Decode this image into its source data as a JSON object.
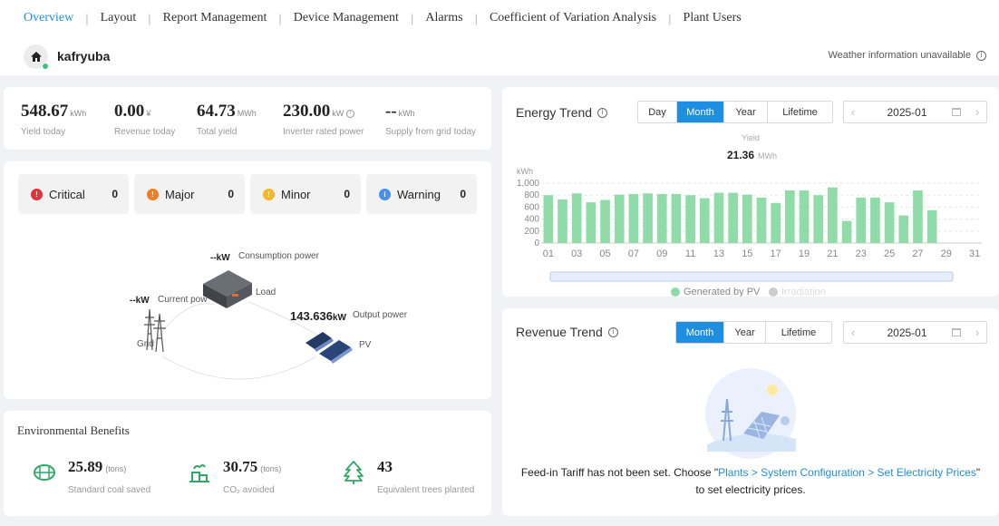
{
  "nav": {
    "items": [
      {
        "label": "Overview",
        "active": true
      },
      {
        "label": "Layout"
      },
      {
        "label": "Report Management"
      },
      {
        "label": "Device Management"
      },
      {
        "label": "Alarms"
      },
      {
        "label": "Coefficient of Variation Analysis"
      },
      {
        "label": "Plant Users"
      }
    ]
  },
  "plant": {
    "name": "kafryuba",
    "status_color": "#3cc27a",
    "weather": "Weather information unavailable"
  },
  "kpis": [
    {
      "value": "548.67",
      "unit": "kWh",
      "label": "Yield today"
    },
    {
      "value": "0.00",
      "unit": "¥",
      "label": "Revenue today"
    },
    {
      "value": "64.73",
      "unit": "MWh",
      "label": "Total yield"
    },
    {
      "value": "230.00",
      "unit": "kW",
      "label": "Inverter rated power"
    },
    {
      "value": "--",
      "unit": "kWh",
      "label": "Supply from grid today"
    }
  ],
  "alarms": [
    {
      "label": "Critical",
      "count": "0",
      "color": "#e0343a",
      "glyph": "!"
    },
    {
      "label": "Major",
      "count": "0",
      "color": "#f07c23",
      "glyph": "!"
    },
    {
      "label": "Minor",
      "count": "0",
      "color": "#f5b62a",
      "glyph": "!"
    },
    {
      "label": "Warning",
      "count": "0",
      "color": "#4a8ef0",
      "glyph": "i"
    }
  ],
  "flow": {
    "consumption_value": "--",
    "consumption_unit": "kW",
    "consumption_label": "Consumption power",
    "load_label": "Load",
    "current_value": "--",
    "current_unit": "kW",
    "current_label": "Current pow",
    "grid_label": "Grid",
    "output_value": "143.636",
    "output_unit": "kW",
    "output_label": "Output power",
    "pv_label": "PV"
  },
  "environment": {
    "title": "Environmental Benefits",
    "items": [
      {
        "value": "25.89",
        "unit": "(tons)",
        "label": "Standard coal saved",
        "icon": "coal-icon"
      },
      {
        "value": "30.75",
        "unit": "(tons)",
        "label": "CO₂ avoided",
        "icon": "co2-icon"
      },
      {
        "value": "43",
        "unit": "",
        "label": "Equivalent trees planted",
        "icon": "tree-icon"
      }
    ]
  },
  "energy_trend": {
    "title": "Energy Trend",
    "tabs": [
      "Day",
      "Month",
      "Year",
      "Lifetime"
    ],
    "active_tab": "Month",
    "date": "2025-01",
    "summary_label": "Yield",
    "summary_value": "21.36",
    "summary_unit": "MWh"
  },
  "revenue_trend": {
    "title": "Revenue Trend",
    "tabs": [
      "Month",
      "Year",
      "Lifetime"
    ],
    "active_tab": "Month",
    "date": "2025-01",
    "msg_prefix": "Feed-in Tariff has not been set. Choose \"",
    "msg_link": "Plants > System Configuration > Set Electricity Prices",
    "msg_suffix": "\"",
    "msg_line2": "to set electricity prices."
  },
  "chart_data": {
    "type": "bar",
    "ylabel": "kWh",
    "ylim": [
      0,
      1000
    ],
    "yticks": [
      0,
      200,
      400,
      600,
      800,
      "1,000"
    ],
    "categories": [
      "01",
      "02",
      "03",
      "04",
      "05",
      "06",
      "07",
      "08",
      "09",
      "10",
      "11",
      "12",
      "13",
      "14",
      "15",
      "16",
      "17",
      "18",
      "19",
      "20",
      "21",
      "22",
      "23",
      "24",
      "25",
      "26",
      "27",
      "28",
      "29",
      "30",
      "31"
    ],
    "xtick_labels": [
      "01",
      "03",
      "05",
      "07",
      "09",
      "11",
      "13",
      "15",
      "17",
      "19",
      "21",
      "23",
      "25",
      "27",
      "29",
      "31"
    ],
    "series": [
      {
        "name": "Generated by PV",
        "color": "#8fdca8",
        "values": [
          800,
          730,
          830,
          680,
          720,
          810,
          820,
          830,
          820,
          820,
          800,
          750,
          840,
          840,
          810,
          760,
          670,
          880,
          880,
          800,
          930,
          370,
          760,
          760,
          680,
          460,
          880,
          550,
          null,
          null,
          null
        ]
      },
      {
        "name": "Irradiation",
        "color": "#cccccc",
        "values": []
      }
    ],
    "legend_position": "bottom",
    "grid": true
  }
}
